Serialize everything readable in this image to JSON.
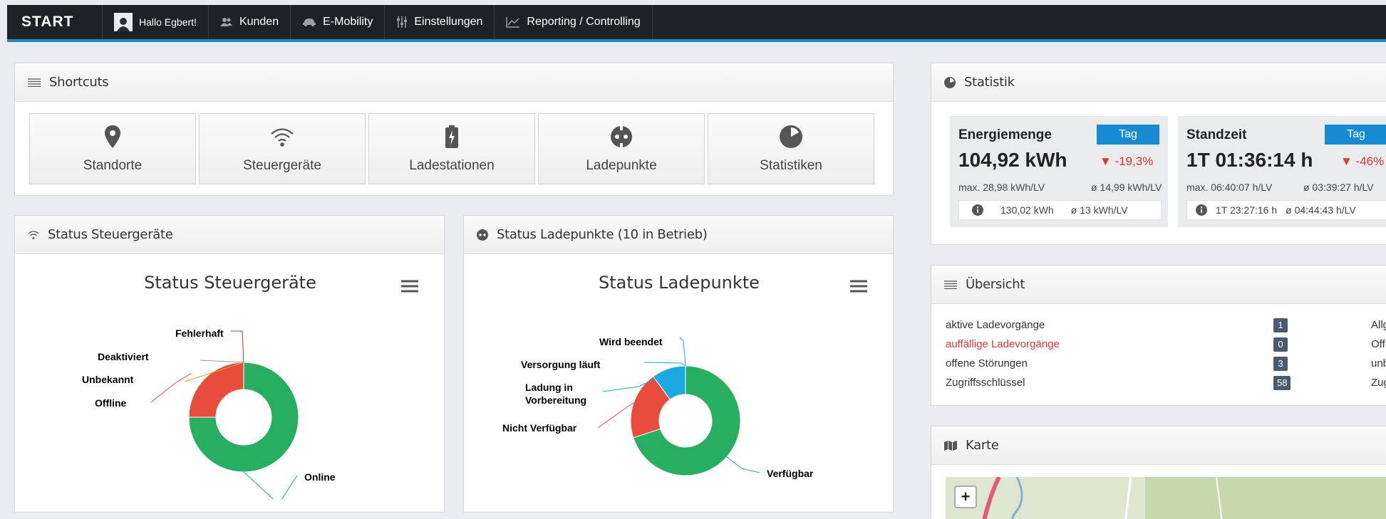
{
  "nav": {
    "logo": "START",
    "greeting": "Hallo Egbert!",
    "items": [
      {
        "label": "Kunden",
        "icon": "users-icon"
      },
      {
        "label": "E-Mobility",
        "icon": "car-icon"
      },
      {
        "label": "Einstellungen",
        "icon": "sliders-icon"
      },
      {
        "label": "Reporting / Controlling",
        "icon": "line-chart-icon"
      }
    ]
  },
  "shortcuts": {
    "title": "Shortcuts",
    "items": [
      {
        "label": "Standorte",
        "icon": "map-marker-icon"
      },
      {
        "label": "Steuergeräte",
        "icon": "wifi-icon"
      },
      {
        "label": "Ladestationen",
        "icon": "battery-charging-icon"
      },
      {
        "label": "Ladepunkte",
        "icon": "plug-icon"
      },
      {
        "label": "Statistiken",
        "icon": "pie-chart-icon"
      }
    ]
  },
  "status_steuergeraete": {
    "panel_title": "Status Steuergeräte",
    "chart_title": "Status Steuergeräte"
  },
  "status_ladepunkte": {
    "panel_title": "Status Ladepunkte (10 in Betrieb)",
    "chart_title": "Status Ladepunkte"
  },
  "chart_data": [
    {
      "type": "pie",
      "title": "Status Steuergeräte",
      "donut": true,
      "categories": [
        "Online",
        "Offline",
        "Unbekannt",
        "Deaktiviert",
        "Fehlerhaft"
      ],
      "values": [
        75,
        25,
        0,
        0,
        0
      ],
      "colors": [
        "#27ae60",
        "#e74c3c",
        "#f39c12",
        "#f1c40f",
        "#c0392b"
      ],
      "label_colors": [
        "#27ae60",
        "#e74c3c",
        "#f39c12",
        "#999999",
        "#c0392b"
      ]
    },
    {
      "type": "pie",
      "title": "Status Ladepunkte",
      "donut": true,
      "categories": [
        "Verfügbar",
        "Nicht Verfügbar",
        "Ladung in Vorbereitung",
        "Versorgung läuft",
        "Wird beendet"
      ],
      "values": [
        70,
        20,
        0,
        10,
        0
      ],
      "colors": [
        "#27ae60",
        "#e74c3c",
        "#1aa9e0",
        "#1aa9e0",
        "#1aa9e0"
      ],
      "label_colors": [
        "#27ae60",
        "#e74c3c",
        "#1aa9e0",
        "#1aa9e0",
        "#1aa9e0"
      ]
    }
  ],
  "statistik": {
    "title": "Statistik",
    "energie": {
      "name": "Energiemenge",
      "period": "Tag",
      "value": "104,92 kWh",
      "change": "▼ -19,3%",
      "max": "max. 28,98 kWh/LV",
      "avg": "ø 14,99 kWh/LV",
      "ref_total": "130,02 kWh",
      "ref_avg": "ø 13 kWh/LV"
    },
    "standzeit": {
      "name": "Standzeit",
      "period": "Tag",
      "value": "1T 01:36:14 h",
      "change": "▼ -46%",
      "max": "max. 06:40:07 h/LV",
      "avg": "ø 03:39:27 h/LV",
      "ref_total": "1T 23:27:16 h",
      "ref_avg": "ø 04:44:43 h/LV"
    }
  },
  "uebersicht": {
    "title": "Übersicht",
    "rows": [
      {
        "label": "aktive Ladevorgänge",
        "count": "1",
        "right": "Allg"
      },
      {
        "label": "auffällige Ladevorgänge",
        "count": "0",
        "right": "Off"
      },
      {
        "label": "offene Störungen",
        "count": "3",
        "right": "unb"
      },
      {
        "label": "Zugriffsschlüssel",
        "count": "58",
        "right": "Zug"
      }
    ]
  },
  "karte": {
    "title": "Karte",
    "zoom_in": "+"
  }
}
